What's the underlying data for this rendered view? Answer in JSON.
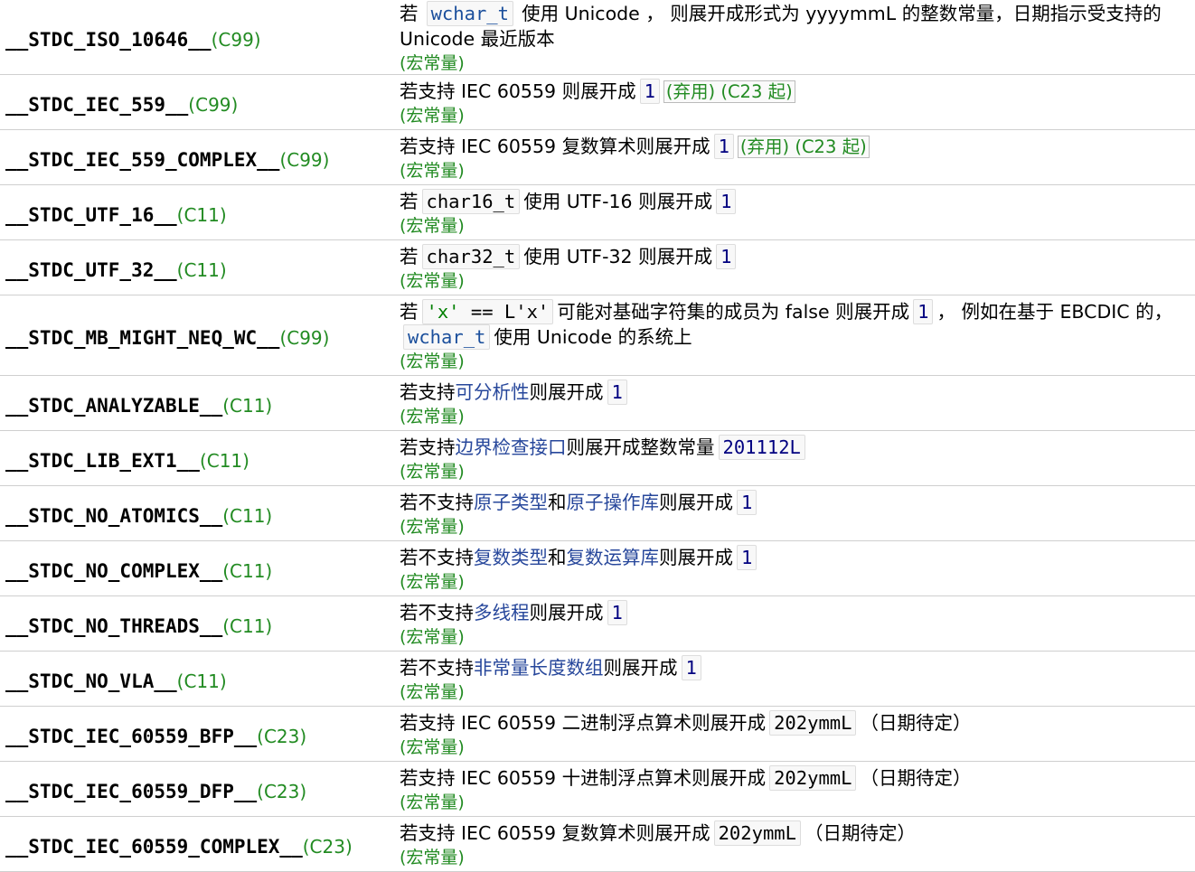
{
  "labels": {
    "macro_constant": "(宏常量)"
  },
  "rows": [
    {
      "name": "__STDC_ISO_10646__",
      "version": "(C99)",
      "desc": {
        "p1": "若",
        "code1": "wchar_t",
        "p2": "使用 Unicode ， 则展开成形式为 yyyymmL 的整数常量，日期指示受支持的 Unicode 最近版本"
      }
    },
    {
      "name": "__STDC_IEC_559__",
      "version": "(C99)",
      "desc": {
        "p1": "若支持 IEC 60559 则展开成",
        "num": "1",
        "tag": "(弃用) (C23 起)"
      }
    },
    {
      "name": "__STDC_IEC_559_COMPLEX__",
      "version": "(C99)",
      "desc": {
        "p1": "若支持 IEC 60559 复数算术则展开成",
        "num": "1",
        "tag": "(弃用) (C23 起)"
      }
    },
    {
      "name": "__STDC_UTF_16__",
      "version": "(C11)",
      "desc": {
        "p1": "若",
        "code1": "char16_t",
        "p2": "使用 UTF-16 则展开成",
        "num": "1"
      }
    },
    {
      "name": "__STDC_UTF_32__",
      "version": "(C11)",
      "desc": {
        "p1": "若",
        "code1": "char32_t",
        "p2": "使用 UTF-32 则展开成",
        "num": "1"
      }
    },
    {
      "name": "__STDC_MB_MIGHT_NEQ_WC__",
      "version": "(C99)",
      "desc": {
        "p1": "若",
        "code_a": "'x'",
        "code_b": "==",
        "code_c": "L'x'",
        "p2": "可能对基础字符集的成员为 false 则展开成",
        "num": "1",
        "p3": "， 例如在基于 EBCDIC 的，",
        "code2": "wchar_t",
        "p4": "使用 Unicode 的系统上"
      }
    },
    {
      "name": "__STDC_ANALYZABLE__",
      "version": "(C11)",
      "desc": {
        "p1": "若支持",
        "link1": "可分析性",
        "p2": "则展开成",
        "num": "1"
      }
    },
    {
      "name": "__STDC_LIB_EXT1__",
      "version": "(C11)",
      "desc": {
        "p1": "若支持",
        "link1": "边界检查接口",
        "p2": "则展开成整数常量",
        "num": "201112L"
      }
    },
    {
      "name": "__STDC_NO_ATOMICS__",
      "version": "(C11)",
      "desc": {
        "p1": "若不支持",
        "link1": "原子类型",
        "p2": "和",
        "link2": "原子操作库",
        "p3": "则展开成",
        "num": "1"
      }
    },
    {
      "name": "__STDC_NO_COMPLEX__",
      "version": "(C11)",
      "desc": {
        "p1": "若不支持",
        "link1": "复数类型",
        "p2": "和",
        "link2": "复数运算库",
        "p3": "则展开成",
        "num": "1"
      }
    },
    {
      "name": "__STDC_NO_THREADS__",
      "version": "(C11)",
      "desc": {
        "p1": "若不支持",
        "link1": "多线程",
        "p2": "则展开成",
        "num": "1"
      }
    },
    {
      "name": "__STDC_NO_VLA__",
      "version": "(C11)",
      "desc": {
        "p1": "若不支持",
        "link1": "非常量长度数组",
        "p2": "则展开成",
        "num": "1"
      }
    },
    {
      "name": "__STDC_IEC_60559_BFP__",
      "version": "(C23)",
      "desc": {
        "p1": "若支持 IEC 60559 二进制浮点算术则展开成",
        "code1": "202ymmL",
        "p2": "（日期待定）"
      }
    },
    {
      "name": "__STDC_IEC_60559_DFP__",
      "version": "(C23)",
      "desc": {
        "p1": "若支持 IEC 60559 十进制浮点算术则展开成",
        "code1": "202ymmL",
        "p2": "（日期待定）"
      }
    },
    {
      "name": "__STDC_IEC_60559_COMPLEX__",
      "version": "(C23)",
      "desc": {
        "p1": "若支持 IEC 60559 复数算术则展开成",
        "code1": "202ymmL",
        "p2": "（日期待定）"
      }
    }
  ]
}
